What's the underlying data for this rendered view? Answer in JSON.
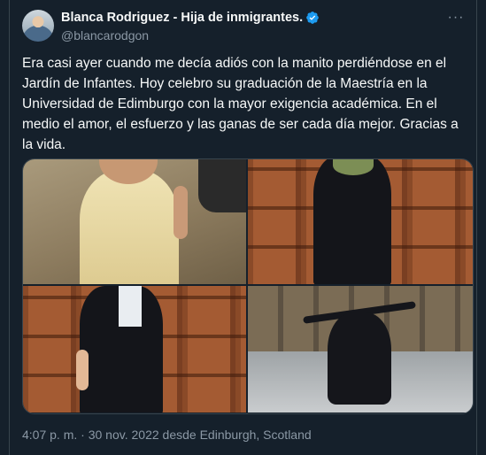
{
  "tweet": {
    "author": {
      "display_name": "Blanca Rodriguez - Hija de inmigrantes.",
      "handle": "@blancarodgon",
      "verified": true,
      "verified_color": "#1d9bf0"
    },
    "more_icon": "more-horizontal-icon",
    "text": "Era casi ayer cuando me decía adiós con la manito perdiéndose en el Jardín de Infantes. Hoy celebro su graduación de la Maestría en la Universidad de Edimburgo con la mayor exigencia académica. En el medio el amor, el esfuerzo y las ganas de ser cada día mejor. Gracias a la vida.",
    "timestamp": {
      "time": "4:07 p. m.",
      "separator": " · ",
      "date": "30 nov. 2022",
      "location_prefix": " desde ",
      "location": "Edinburgh, Scotland"
    }
  },
  "theme": {
    "background": "#15202b",
    "text": "#f7f9f9",
    "secondary_text": "#8b98a5",
    "border": "#38444d"
  }
}
